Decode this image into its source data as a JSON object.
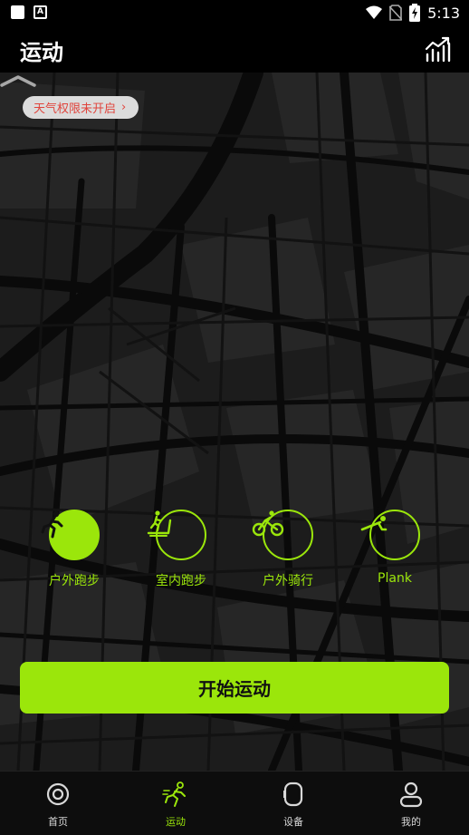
{
  "status_bar": {
    "time": "5:13"
  },
  "app_bar": {
    "title": "运动"
  },
  "weather": {
    "label": "天气权限未开启"
  },
  "sports": [
    {
      "label": "户外跑步",
      "icon": "outdoor-run-icon",
      "selected": true
    },
    {
      "label": "室内跑步",
      "icon": "treadmill-icon",
      "selected": false
    },
    {
      "label": "户外骑行",
      "icon": "bike-icon",
      "selected": false
    },
    {
      "label": "Plank",
      "icon": "plank-icon",
      "selected": false
    }
  ],
  "start_button": {
    "label": "开始运动"
  },
  "tabs": [
    {
      "label": "首页",
      "icon": "home-icon",
      "active": false
    },
    {
      "label": "运动",
      "icon": "run-icon",
      "active": true
    },
    {
      "label": "设备",
      "icon": "watch-icon",
      "active": false
    },
    {
      "label": "我的",
      "icon": "profile-icon",
      "active": false
    }
  ],
  "colors": {
    "accent": "#9be60b",
    "map_bg": "#1c1c1c",
    "warning": "#e0443c"
  }
}
